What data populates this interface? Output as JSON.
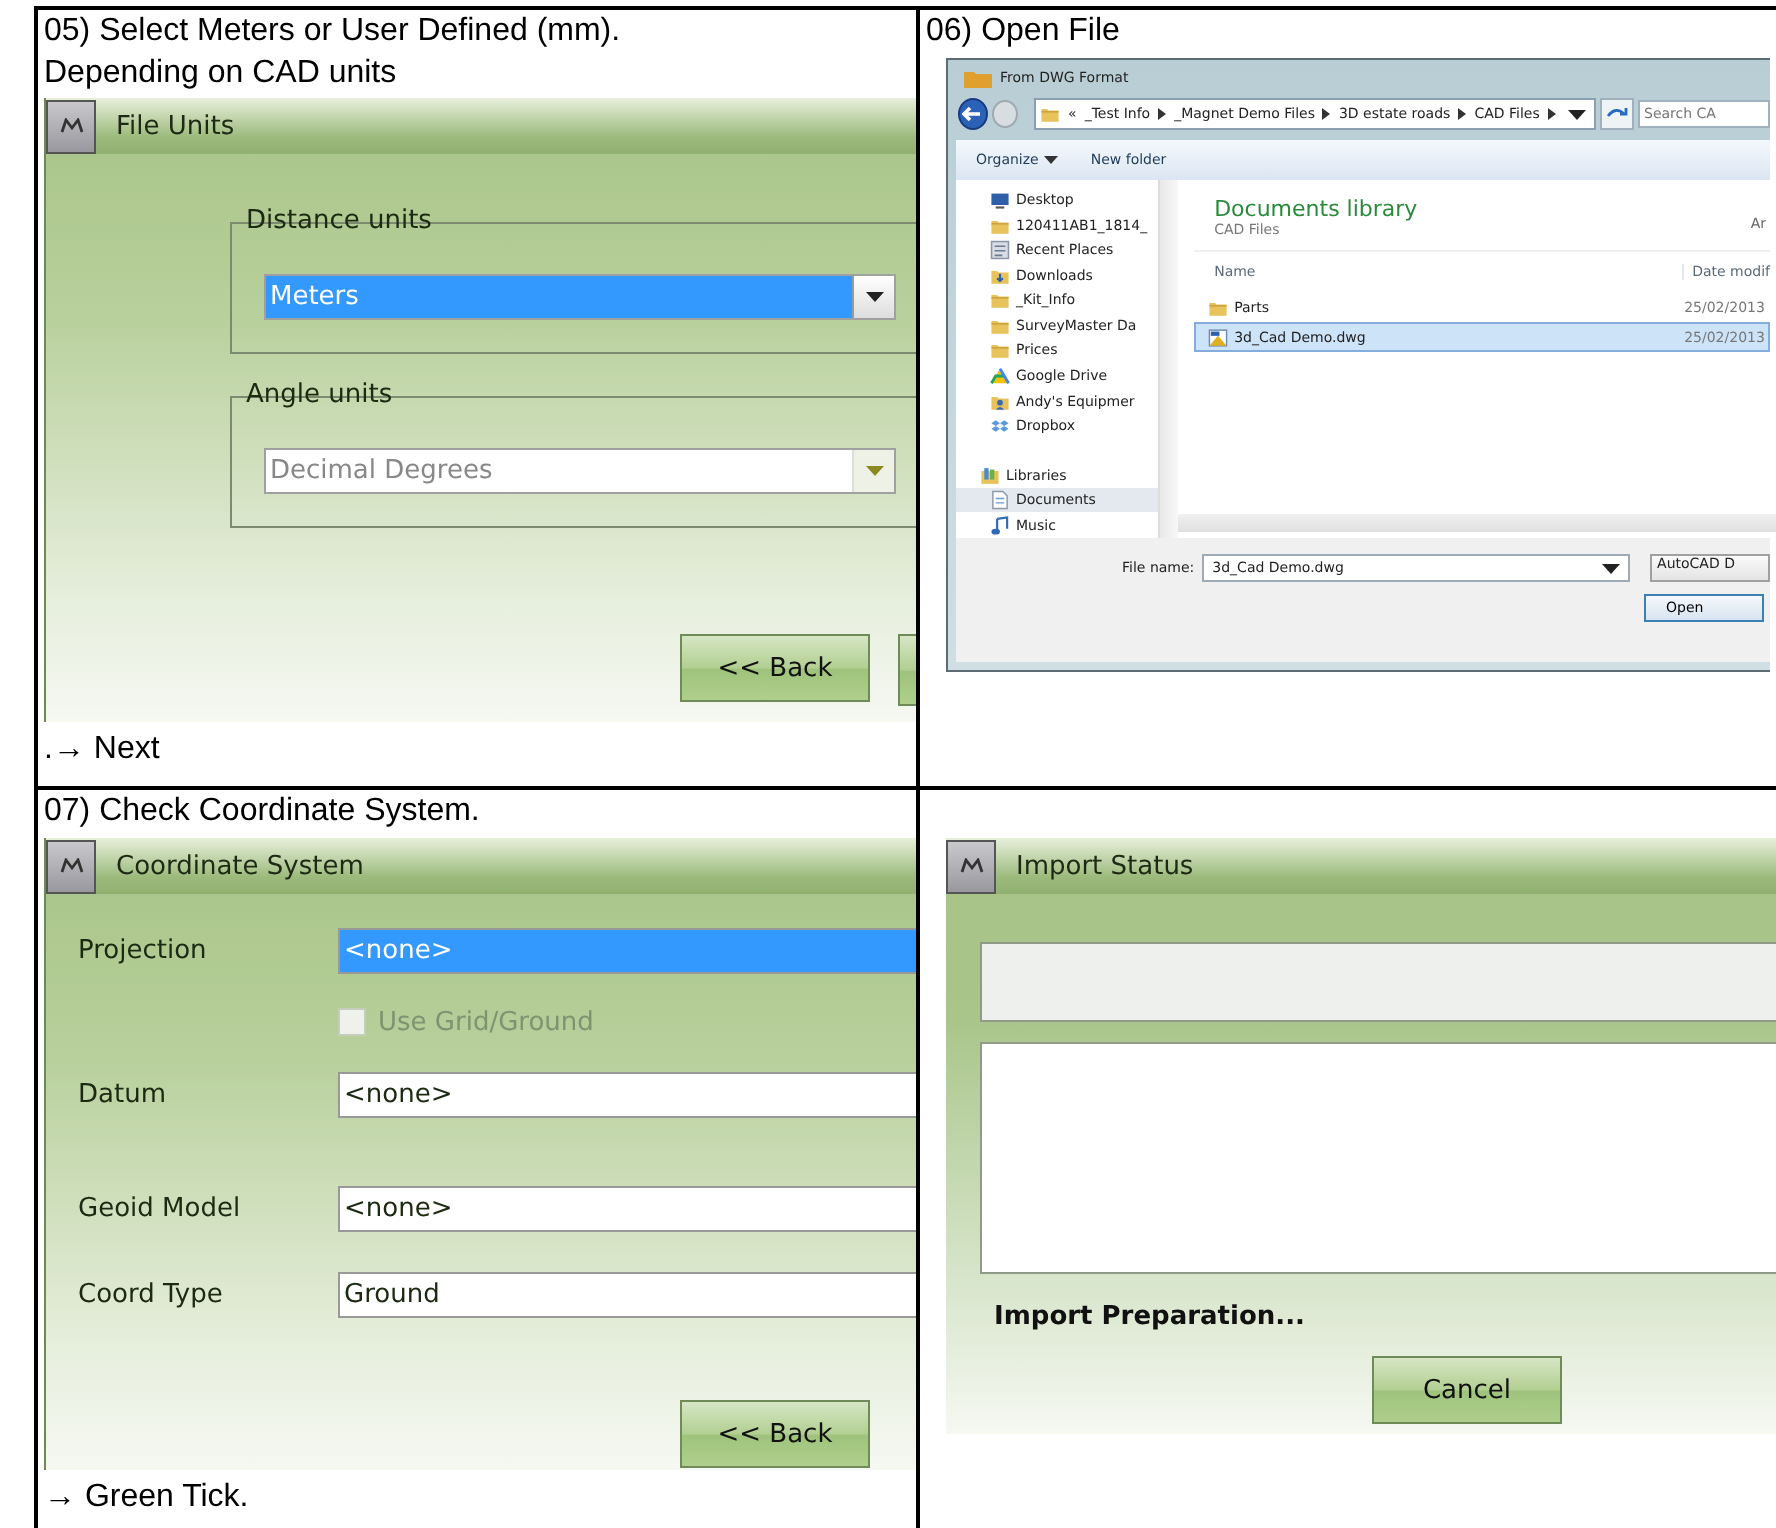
{
  "cells": [
    {
      "kind": "file_units",
      "caption": [
        "05) Select Meters or User Defined (mm).",
        "Depending on CAD units"
      ],
      "screen": {
        "title": "File Units",
        "groups": [
          {
            "label": "Distance units",
            "value": "Meters",
            "selected": true,
            "disabled": false
          },
          {
            "label": "Angle units",
            "value": "Decimal Degrees",
            "selected": false,
            "disabled": true
          }
        ],
        "buttons": [
          "<< Back"
        ]
      },
      "note": ".→ Next"
    },
    {
      "kind": "open_dialog",
      "caption": [
        "06) Open File"
      ],
      "screen": {
        "title": "From DWG Format",
        "breadcrumb": [
          "«",
          "_Test Info",
          "_Magnet Demo Files",
          "3D estate roads",
          "CAD Files"
        ],
        "search": {
          "placeholder": "Search CA"
        },
        "toolbar": [
          "Organize",
          "New folder"
        ],
        "nav": [
          {
            "label": "Desktop",
            "kind": "desktop",
            "selected": false
          },
          {
            "label": "120411AB1_1814_",
            "kind": "folder",
            "selected": false
          },
          {
            "label": "Recent Places",
            "kind": "recent",
            "selected": false
          },
          {
            "label": "Downloads",
            "kind": "download",
            "selected": false
          },
          {
            "label": "_Kit_Info",
            "kind": "folder",
            "selected": false
          },
          {
            "label": "SurveyMaster Da",
            "kind": "folder",
            "selected": false
          },
          {
            "label": "Prices",
            "kind": "folder",
            "selected": false
          },
          {
            "label": "Google Drive",
            "kind": "drive",
            "selected": false
          },
          {
            "label": "Andy's Equipmer",
            "kind": "user",
            "selected": false
          },
          {
            "label": "Dropbox",
            "kind": "box",
            "selected": false
          },
          {
            "label": "Libraries",
            "kind": "library",
            "selected": false
          },
          {
            "label": "Documents",
            "kind": "document",
            "selected": true
          },
          {
            "label": "Music",
            "kind": "music",
            "selected": false
          }
        ],
        "library": {
          "title": "Documents library",
          "subtitle": "CAD Files",
          "arrange": "Ar"
        },
        "columns": [
          "Name",
          "Date modif"
        ],
        "rows": [
          {
            "name": "Parts",
            "date": "25/02/2013",
            "kind": "folder",
            "selected": false
          },
          {
            "name": "3d_Cad Demo.dwg",
            "date": "25/02/2013",
            "kind": "drawing",
            "selected": true
          }
        ],
        "file_name_label": "File name:",
        "file_name": "3d_Cad Demo.dwg",
        "filter": "AutoCAD D",
        "open_button": "Open"
      }
    },
    {
      "kind": "coordinate_system",
      "caption": [
        "07) Check Coordinate System."
      ],
      "screen": {
        "title": "Coordinate System",
        "rows": [
          {
            "kind": "field",
            "label": "Projection",
            "value": "<none>",
            "selected": true
          },
          {
            "kind": "checkbox",
            "label": "Use Grid/Ground",
            "checked": false,
            "disabled": true
          },
          {
            "kind": "field",
            "label": "Datum",
            "value": "<none>",
            "selected": false
          },
          {
            "kind": "field",
            "label": "Geoid Model",
            "value": "<none>",
            "selected": false
          },
          {
            "kind": "field",
            "label": "Coord Type",
            "value": "Ground",
            "selected": false
          }
        ],
        "buttons": [
          "<< Back"
        ]
      },
      "note": "→ Green Tick."
    },
    {
      "kind": "import_status",
      "screen": {
        "title": "Import Status",
        "status": "Import Preparation...",
        "buttons": [
          "Cancel"
        ]
      }
    }
  ]
}
